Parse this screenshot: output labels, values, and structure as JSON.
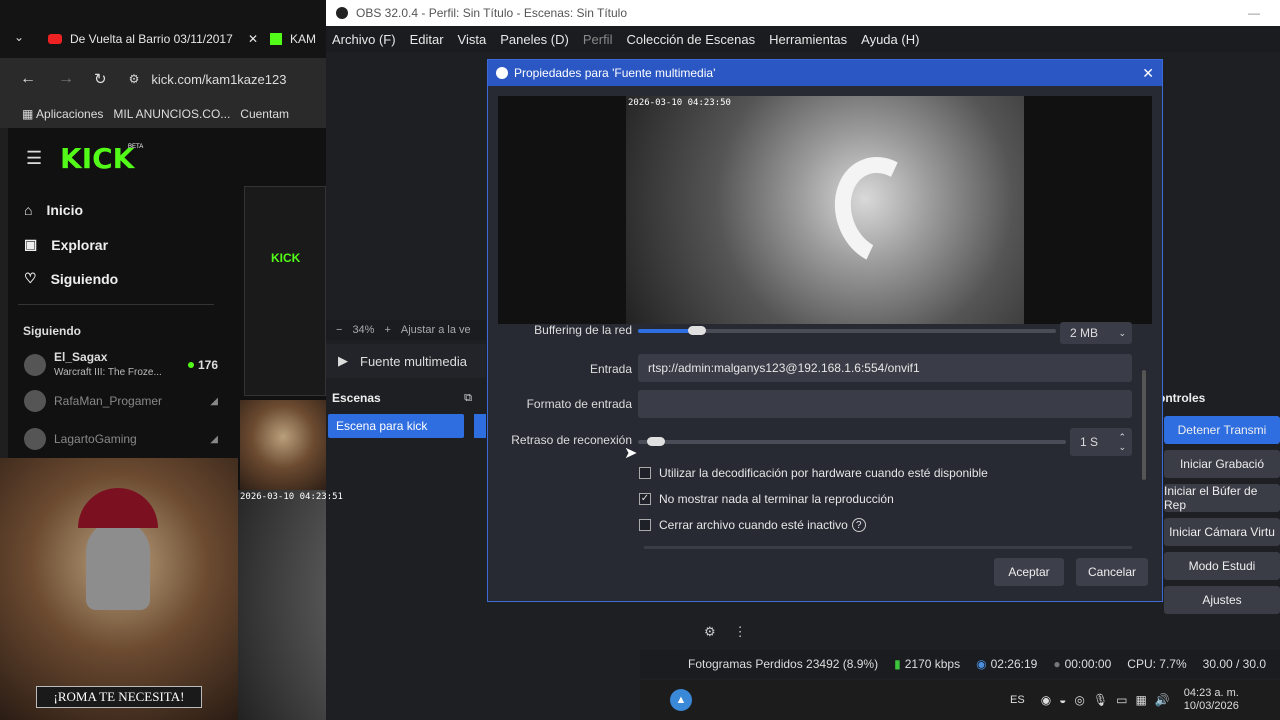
{
  "browser": {
    "tabs": [
      {
        "label": "De Vuelta al Barrio 03/11/2017"
      },
      {
        "label": "KAM"
      }
    ],
    "address": "kick.com/kam1kaze123",
    "bookmarks": [
      "Aplicaciones",
      "MIL ANUNCIOS.CO...",
      "Cuentam"
    ]
  },
  "kick": {
    "logo": "KICK",
    "beta": "BETA",
    "nav": [
      {
        "label": "Inicio",
        "icon": "home-icon"
      },
      {
        "label": "Explorar",
        "icon": "compass-icon"
      },
      {
        "label": "Siguiendo",
        "icon": "heart-icon"
      }
    ],
    "following_title": "Siguiendo",
    "following": [
      {
        "name": "El_Sagax",
        "sub": "Warcraft III: The Froze...",
        "count": "176",
        "live": true
      },
      {
        "name": "RafaMan_Progamer",
        "sub": "",
        "count": "",
        "live": false
      },
      {
        "name": "LagartoGaming",
        "sub": "",
        "count": "",
        "live": false
      }
    ]
  },
  "poster": {
    "caption": "¡ROMA TE NECESITA!"
  },
  "cam_overlay": {
    "timestamp": "2026-03-10 04:23:51"
  },
  "obs": {
    "window_title": "OBS 32.0.4 - Perfil: Sin Título - Escenas: Sin Título",
    "menu": [
      "Archivo (F)",
      "Editar",
      "Vista",
      "Paneles (D)",
      "Perfil",
      "Colección de Escenas",
      "Herramientas",
      "Ayuda (H)"
    ],
    "zoom": "34%",
    "zoom_hint": "Ajustar a la ve",
    "source_name": "Fuente multimedia",
    "scenes_title": "Escenas",
    "scenes": [
      "Escena para kick"
    ],
    "controls_title": "ontroles",
    "controls": [
      "Detener Transmi",
      "Iniciar Grabació",
      "Iniciar el Búfer de Rep",
      "Iniciar Cámara Virtu",
      "Modo Estudi",
      "Ajustes"
    ],
    "status": {
      "dropped": "Fotogramas Perdidos 23492 (8.9%)",
      "bitrate": "2170 kbps",
      "stream_time": "02:26:19",
      "rec_time": "00:00:00",
      "cpu": "CPU: 7.7%",
      "fps": "30.00 / 30.0"
    }
  },
  "dialog": {
    "title": "Propiedades para 'Fuente multimedia'",
    "preview_timestamp": "2026-03-10 04:23:50",
    "buffering_label": "Buffering de la red",
    "buffering_value": "2 MB",
    "buffering_level": 0.14,
    "input_label": "Entrada",
    "input_value": "rtsp://admin:malganys123@192.168.1.6:554/onvif1",
    "format_label": "Formato de entrada",
    "format_value": "",
    "reconnect_label": "Retraso de reconexión",
    "reconnect_value": "1 S",
    "reconnect_level": 0.02,
    "checkboxes": [
      {
        "label": "Utilizar la decodificación por hardware cuando esté disponible",
        "checked": false
      },
      {
        "label": "No mostrar nada al terminar la reproducción",
        "checked": true
      },
      {
        "label": "Cerrar archivo cuando esté inactivo",
        "checked": false
      }
    ],
    "ok": "Aceptar",
    "cancel": "Cancelar"
  },
  "taskbar": {
    "lang": "ES",
    "time": "04:23 a. m.",
    "date": "10/03/2026"
  }
}
